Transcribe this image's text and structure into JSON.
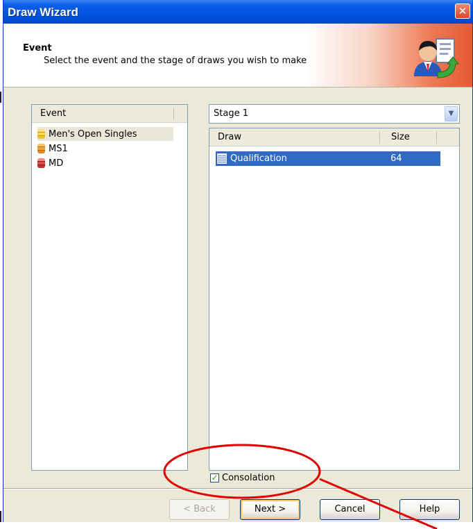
{
  "window": {
    "title": "Draw Wizard",
    "close_glyph": "✕"
  },
  "header": {
    "title": "Event",
    "subtitle": "Select the event and the stage of draws you wish to make",
    "icon": "user-document-icon"
  },
  "event_list": {
    "column_header": "Event",
    "items": [
      {
        "label": "Men's Open Singles",
        "icon": "database-yellow-icon",
        "selected": true
      },
      {
        "label": "MS1",
        "icon": "database-orange-icon",
        "selected": false
      },
      {
        "label": "MD",
        "icon": "database-red-icon",
        "selected": false
      }
    ]
  },
  "stage_select": {
    "value": "Stage 1"
  },
  "draw_table": {
    "headers": [
      "Draw",
      "Size"
    ],
    "rows": [
      {
        "draw": "Qualification",
        "size": "64",
        "selected": true
      }
    ]
  },
  "consolation": {
    "label": "Consolation",
    "checked": true
  },
  "buttons": {
    "back": "< Back",
    "next": "Next >",
    "cancel": "Cancel",
    "help": "Help"
  },
  "colors": {
    "titlebar": "#0055e5",
    "selection": "#316ac5",
    "annotation": "#e00000"
  }
}
